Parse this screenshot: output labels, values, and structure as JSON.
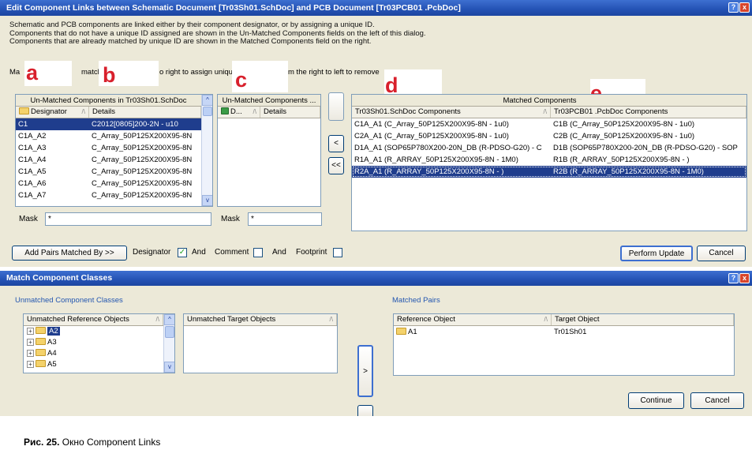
{
  "dialog1": {
    "title": "Edit Component Links between Schematic Document [Tr03Sh01.SchDoc] and PCB Document [Tr03PCB01 .PcbDoc]",
    "help_btn": "?",
    "close_btn": "x",
    "info": [
      "Schematic and PCB components are linked either by their component designator, or by assigning a unique ID.",
      "Components that do not have a unique ID assigned are shown in the Un-Matched Components fields on the left of this dialog.",
      "Components that are already matched by unique ID are shown in the Matched Components field on the right."
    ],
    "hint": {
      "p1": "Ma",
      "p2": "match",
      "p3": "o right to assign uniqu",
      "p4": "m the right to left to remove"
    },
    "letters": {
      "a": "a",
      "b": "b",
      "c": "c",
      "d": "d",
      "e": "e"
    },
    "unmatched_sch": {
      "title": "Un-Matched Components in Tr03Sh01.SchDoc",
      "columns": [
        "Designator",
        "Details"
      ],
      "rows": [
        [
          "C1",
          "C2012[0805]200-2N - u10"
        ],
        [
          "C1A_A2",
          "C_Array_50P125X200X95-8N"
        ],
        [
          "C1A_A3",
          "C_Array_50P125X200X95-8N"
        ],
        [
          "C1A_A4",
          "C_Array_50P125X200X95-8N"
        ],
        [
          "C1A_A5",
          "C_Array_50P125X200X95-8N"
        ],
        [
          "C1A_A6",
          "C_Array_50P125X200X95-8N"
        ],
        [
          "C1A_A7",
          "C_Array_50P125X200X95-8N"
        ]
      ],
      "mask_label": "Mask",
      "mask_value": "*"
    },
    "unmatched_pcb": {
      "title": "Un-Matched Components ...",
      "columns": [
        "D...",
        "Details"
      ],
      "mask_label": "Mask",
      "mask_value": "*"
    },
    "mid_buttons": {
      "move_one": "<",
      "move_all": "<<"
    },
    "matched": {
      "title": "Matched Components",
      "columns": [
        "Tr03Sh01.SchDoc Components",
        "Tr03PCB01 .PcbDoc Components"
      ],
      "rows": [
        [
          "C1A_A1 (C_Array_50P125X200X95-8N - 1u0)",
          "C1B (C_Array_50P125X200X95-8N - 1u0)"
        ],
        [
          "C2A_A1 (C_Array_50P125X200X95-8N - 1u0)",
          "C2B (C_Array_50P125X200X95-8N - 1u0)"
        ],
        [
          "D1A_A1 (SOP65P780X200-20N_DB (R-PDSO-G20) - C",
          "D1B (SOP65P780X200-20N_DB (R-PDSO-G20) - SOP"
        ],
        [
          "R1A_A1 (R_ARRAY_50P125X200X95-8N - 1M0)",
          "R1B (R_ARRAY_50P125X200X95-8N - )"
        ],
        [
          "R2A_A1 (R_ARRAY_50P125X200X95-8N - )",
          "R2B (R_ARRAY_50P125X200X95-8N - 1M0)"
        ]
      ]
    },
    "bottom": {
      "add_pairs": "Add Pairs Matched By >>",
      "designator": "Designator",
      "and1": "And",
      "comment": "Comment",
      "and2": "And",
      "footprint": "Footprint",
      "check_mark": "✓",
      "perform_update": "Perform Update",
      "cancel": "Cancel"
    }
  },
  "dialog2": {
    "title": "Match Component Classes",
    "help_btn": "?",
    "close_btn": "x",
    "unmatched_classes_caption": "Unmatched Component Classes",
    "unmatched_ref": {
      "title": "Unmatched Reference Objects",
      "items": [
        "A2",
        "A3",
        "A4",
        "A5"
      ]
    },
    "unmatched_target": {
      "title": "Unmatched Target Objects"
    },
    "matched_pairs_caption": "Matched Pairs",
    "pairs": {
      "columns": [
        "Reference Object",
        "Target Object"
      ],
      "rows": [
        [
          "A1",
          "Tr01Sh01"
        ]
      ]
    },
    "move_btn": ">",
    "continue": "Continue",
    "cancel": "Cancel"
  },
  "caption": {
    "label": "Рис. 25.",
    "text": "Окно Component Links"
  }
}
